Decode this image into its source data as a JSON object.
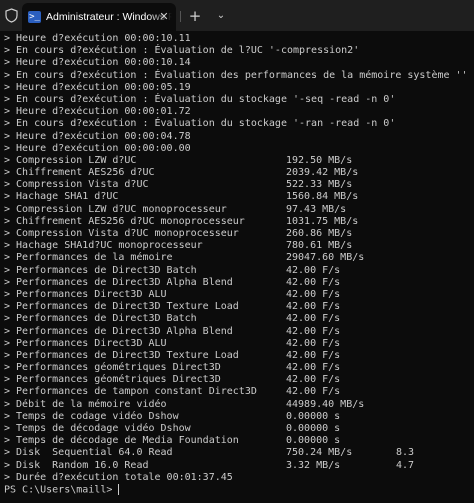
{
  "window": {
    "tab_title": "Administrateur : Windows PowerShell",
    "tab_close_glyph": "✕",
    "new_tab_glyph": "+",
    "dropdown_glyph": "⌄",
    "ps_glyph": ">_"
  },
  "terminal": {
    "lines": [
      {
        "c1": "> Heure d?exécution 00:00:10.11",
        "c2": "",
        "c3": ""
      },
      {
        "c1": "> En cours d?exécution : Évaluation de l?UC '-compression2'",
        "c2": "",
        "c3": ""
      },
      {
        "c1": "> Heure d?exécution 00:00:10.14",
        "c2": "",
        "c3": ""
      },
      {
        "c1": "> En cours d?exécution : Évaluation des performances de la mémoire système ''",
        "c2": "",
        "c3": ""
      },
      {
        "c1": "> Heure d?exécution 00:00:05.19",
        "c2": "",
        "c3": ""
      },
      {
        "c1": "> En cours d?exécution : Évaluation du stockage '-seq -read -n 0'",
        "c2": "",
        "c3": ""
      },
      {
        "c1": "> Heure d?exécution 00:00:01.72",
        "c2": "",
        "c3": ""
      },
      {
        "c1": "> En cours d?exécution : Évaluation du stockage '-ran -read -n 0'",
        "c2": "",
        "c3": ""
      },
      {
        "c1": "> Heure d?exécution 00:00:04.78",
        "c2": "",
        "c3": ""
      },
      {
        "c1": "> Heure d?exécution 00:00:00.00",
        "c2": "",
        "c3": ""
      },
      {
        "c1": "> Compression LZW d?UC",
        "c2": "192.50 MB/s",
        "c3": ""
      },
      {
        "c1": "> Chiffrement AES256 d?UC",
        "c2": "2039.42 MB/s",
        "c3": ""
      },
      {
        "c1": "> Compression Vista d?UC",
        "c2": "522.33 MB/s",
        "c3": ""
      },
      {
        "c1": "> Hachage SHA1 d?UC",
        "c2": "1560.84 MB/s",
        "c3": ""
      },
      {
        "c1": "> Compression LZW d?UC monoprocesseur",
        "c2": "97.43 MB/s",
        "c3": ""
      },
      {
        "c1": "> Chiffrement AES256 d?UC monoprocesseur",
        "c2": "1031.75 MB/s",
        "c3": ""
      },
      {
        "c1": "> Compression Vista d?UC monoprocesseur",
        "c2": "260.86 MB/s",
        "c3": ""
      },
      {
        "c1": "> Hachage SHA1d?UC monoprocesseur",
        "c2": "780.61 MB/s",
        "c3": ""
      },
      {
        "c1": "> Performances de la mémoire",
        "c2": "29047.60 MB/s",
        "c3": ""
      },
      {
        "c1": "> Performances de Direct3D Batch",
        "c2": "42.00 F/s",
        "c3": ""
      },
      {
        "c1": "> Performances de Direct3D Alpha Blend",
        "c2": "42.00 F/s",
        "c3": ""
      },
      {
        "c1": "> Performances Direct3D ALU",
        "c2": "42.00 F/s",
        "c3": ""
      },
      {
        "c1": "> Performances de Direct3D Texture Load",
        "c2": "42.00 F/s",
        "c3": ""
      },
      {
        "c1": "> Performances de Direct3D Batch",
        "c2": "42.00 F/s",
        "c3": ""
      },
      {
        "c1": "> Performances de Direct3D Alpha Blend",
        "c2": "42.00 F/s",
        "c3": ""
      },
      {
        "c1": "> Performances Direct3D ALU",
        "c2": "42.00 F/s",
        "c3": ""
      },
      {
        "c1": "> Performances de Direct3D Texture Load",
        "c2": "42.00 F/s",
        "c3": ""
      },
      {
        "c1": "> Performances géométriques Direct3D",
        "c2": "42.00 F/s",
        "c3": ""
      },
      {
        "c1": "> Performances géométriques Direct3D",
        "c2": "42.00 F/s",
        "c3": ""
      },
      {
        "c1": "> Performances de tampon constant Direct3D",
        "c2": "42.00 F/s",
        "c3": ""
      },
      {
        "c1": "> Débit de la mémoire vidéo",
        "c2": "44989.40 MB/s",
        "c3": ""
      },
      {
        "c1": "> Temps de codage vidéo Dshow",
        "c2": "0.00000 s",
        "c3": ""
      },
      {
        "c1": "> Temps de décodage vidéo Dshow",
        "c2": "0.00000 s",
        "c3": ""
      },
      {
        "c1": "> Temps de décodage de Media Foundation",
        "c2": "0.00000 s",
        "c3": ""
      },
      {
        "c1": "> Disk  Sequential 64.0 Read",
        "c2": "750.24 MB/s",
        "c3": "8.3"
      },
      {
        "c1": "> Disk  Random 16.0 Read",
        "c2": "3.32 MB/s",
        "c3": "4.7"
      },
      {
        "c1": "> Durée d?exécution totale 00:01:37.45",
        "c2": "",
        "c3": ""
      }
    ],
    "prompt": "PS C:\\Users\\maill> "
  }
}
